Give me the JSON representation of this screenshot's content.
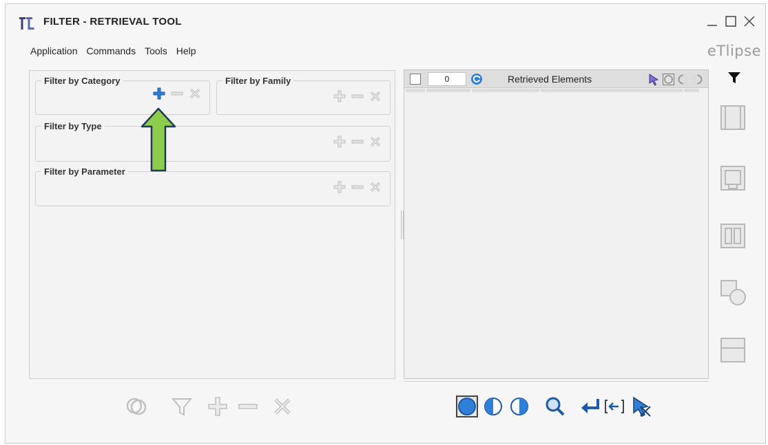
{
  "window": {
    "title": "FILTER - RETRIEVAL TOOL",
    "brand": "eTlipse"
  },
  "menu": {
    "items": [
      "Application",
      "Commands",
      "Tools",
      "Help"
    ]
  },
  "left_panel": {
    "filter_category_label": "Filter by Category",
    "filter_family_label": "Filter by Family",
    "filter_type_label": "Filter by Type",
    "filter_parameter_label": "Filter by Parameter"
  },
  "right_panel": {
    "count": "0",
    "title": "Retrieved Elements"
  },
  "colors": {
    "accent_blue": "#2f7fd8",
    "icon_gray": "#bdbdbd",
    "arrow_green": "#8fcc4e",
    "arrow_border": "#1f3a52"
  },
  "icons": {
    "app": "app-logo-icon",
    "minimize": "minimize-icon",
    "maximize": "maximize-icon",
    "close": "close-icon",
    "add": "plus-icon",
    "remove": "minus-icon",
    "clear": "x-icon",
    "refresh": "refresh-icon",
    "select": "cursor-select-icon",
    "filter": "funnel-icon",
    "search": "magnifier-icon",
    "enter": "enter-arrow-icon"
  }
}
